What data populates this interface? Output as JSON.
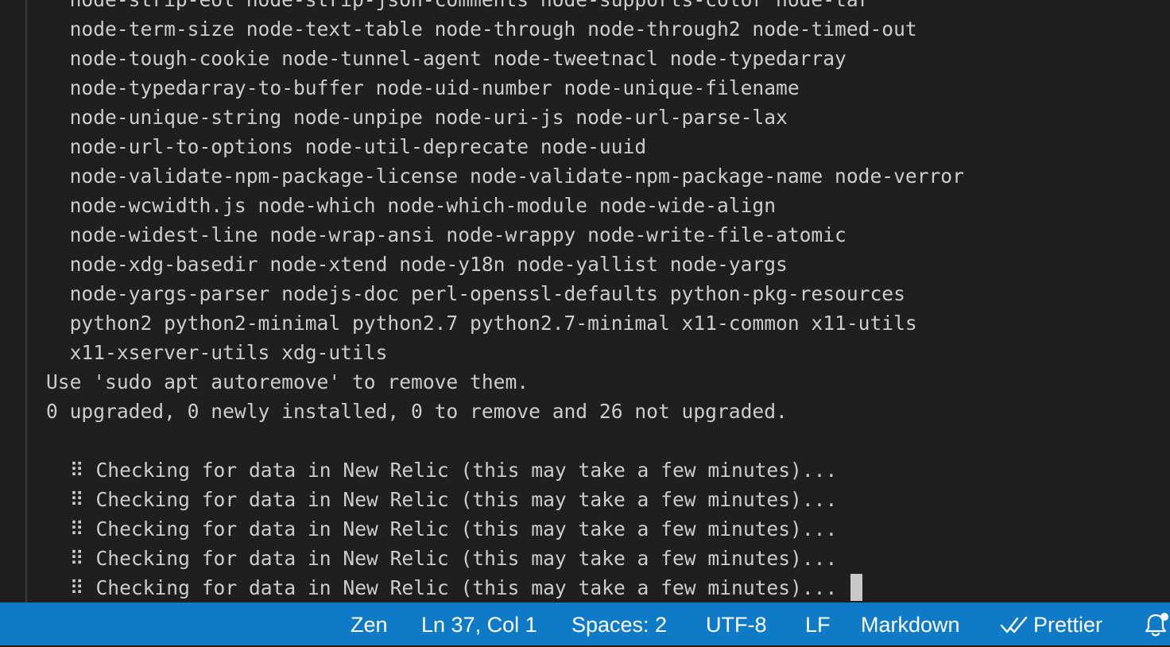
{
  "terminal": {
    "lines": [
      "  node-strip-eol node-strip-json-comments node-supports-color node-tar",
      "  node-term-size node-text-table node-through node-through2 node-timed-out",
      "  node-tough-cookie node-tunnel-agent node-tweetnacl node-typedarray",
      "  node-typedarray-to-buffer node-uid-number node-unique-filename",
      "  node-unique-string node-unpipe node-uri-js node-url-parse-lax",
      "  node-url-to-options node-util-deprecate node-uuid",
      "  node-validate-npm-package-license node-validate-npm-package-name node-verror",
      "  node-wcwidth.js node-which node-which-module node-wide-align",
      "  node-widest-line node-wrap-ansi node-wrappy node-write-file-atomic",
      "  node-xdg-basedir node-xtend node-y18n node-yallist node-yargs",
      "  node-yargs-parser nodejs-doc perl-openssl-defaults python-pkg-resources",
      "  python2 python2-minimal python2.7 python2.7-minimal x11-common x11-utils",
      "  x11-xserver-utils xdg-utils",
      "Use 'sudo apt autoremove' to remove them.",
      "0 upgraded, 0 newly installed, 0 to remove and 26 not upgraded.",
      ""
    ],
    "spinner_glyph": "⠿",
    "spinner_lines": [
      "Checking for data in New Relic (this may take a few minutes)...",
      "Checking for data in New Relic (this may take a few minutes)...",
      "Checking for data in New Relic (this may take a few minutes)...",
      "Checking for data in New Relic (this may take a few minutes)...",
      "Checking for data in New Relic (this may take a few minutes)..."
    ]
  },
  "statusbar": {
    "zen": "Zen",
    "cursor_position": "Ln 37, Col 1",
    "indentation": "Spaces: 2",
    "encoding": "UTF-8",
    "eol": "LF",
    "language": "Markdown",
    "formatter": "Prettier",
    "formatter_icon": "double-check-icon",
    "notifications_icon": "bell-icon",
    "background_color": "#0f7ac6"
  }
}
